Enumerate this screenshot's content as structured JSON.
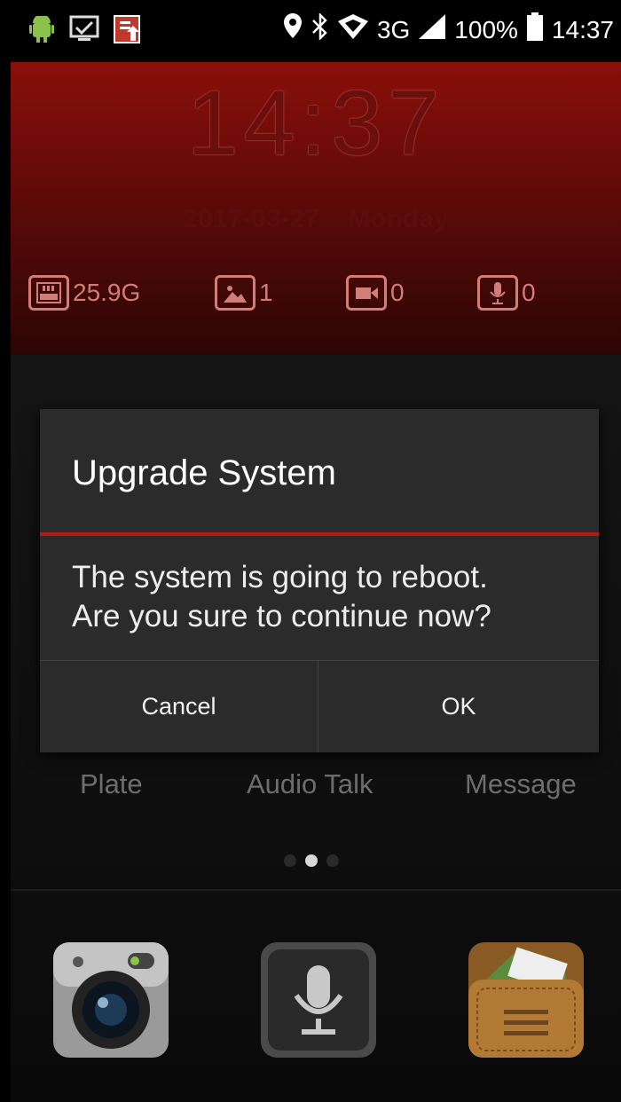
{
  "status_bar": {
    "network": "3G",
    "battery": "100%",
    "time": "14:37",
    "icons_left": [
      "android-icon",
      "screen-icon",
      "doc-upload-icon"
    ],
    "icons_right": [
      "location-icon",
      "bluetooth-icon",
      "wifi-icon",
      "signal-icon",
      "battery-icon"
    ]
  },
  "lock_header": {
    "clock": "14:37",
    "date": "2017-03-27",
    "weekday": "Monday",
    "stats": [
      {
        "icon": "ram-icon",
        "value": "25.9G"
      },
      {
        "icon": "image-icon",
        "value": "1"
      },
      {
        "icon": "video-icon",
        "value": "0"
      },
      {
        "icon": "mic-icon",
        "value": "0"
      }
    ]
  },
  "home": {
    "labels": [
      "Plate",
      "Audio Talk",
      "Message"
    ],
    "page_indicator": {
      "count": 3,
      "active_index": 1
    },
    "dock_apps": [
      "camera-app",
      "recorder-app",
      "notes-app"
    ]
  },
  "dialog": {
    "title": "Upgrade System",
    "message": "The system is going to reboot.\nAre you sure to continue now?",
    "cancel_label": "Cancel",
    "ok_label": "OK"
  },
  "colors": {
    "accent_red": "#b21c18",
    "header_red": "#8a0f0b"
  }
}
